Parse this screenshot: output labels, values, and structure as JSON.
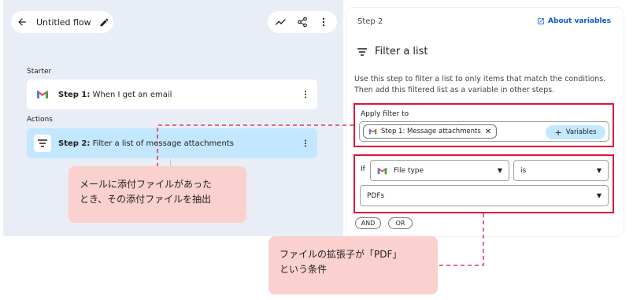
{
  "header": {
    "flow_title": "Untitled flow"
  },
  "flow": {
    "starter_label": "Starter",
    "actions_label": "Actions",
    "step1": {
      "prefix": "Step 1:",
      "text": "When I get an email"
    },
    "step2": {
      "prefix": "Step 2:",
      "text": "Filter a list of message attachments"
    }
  },
  "panel": {
    "step_label": "Step 2",
    "about_link": "About variables",
    "title": "Filter a list",
    "description": "Use this step to filter a list to only items that match the conditions. Then add this filtered list as a variable in other steps.",
    "apply_label": "Apply filter to",
    "chip_text": "Step 1: Message attachments",
    "variables_button": "Variables",
    "if_label": "If",
    "condition_field": "File type",
    "operator": "is",
    "value": "PDFs",
    "and_button": "AND",
    "or_button": "OR"
  },
  "callouts": {
    "one_line1": "メールに添付ファイルがあった",
    "one_line2": "とき、その添付ファイルを抽出",
    "two_line1": "ファイルの拡張子が「PDF」",
    "two_line2": "という条件"
  },
  "colors": {
    "accent": "#0b57d0",
    "highlight": "#c2e7ff",
    "annotation": "#e0143c",
    "callout": "#fad1cf"
  }
}
